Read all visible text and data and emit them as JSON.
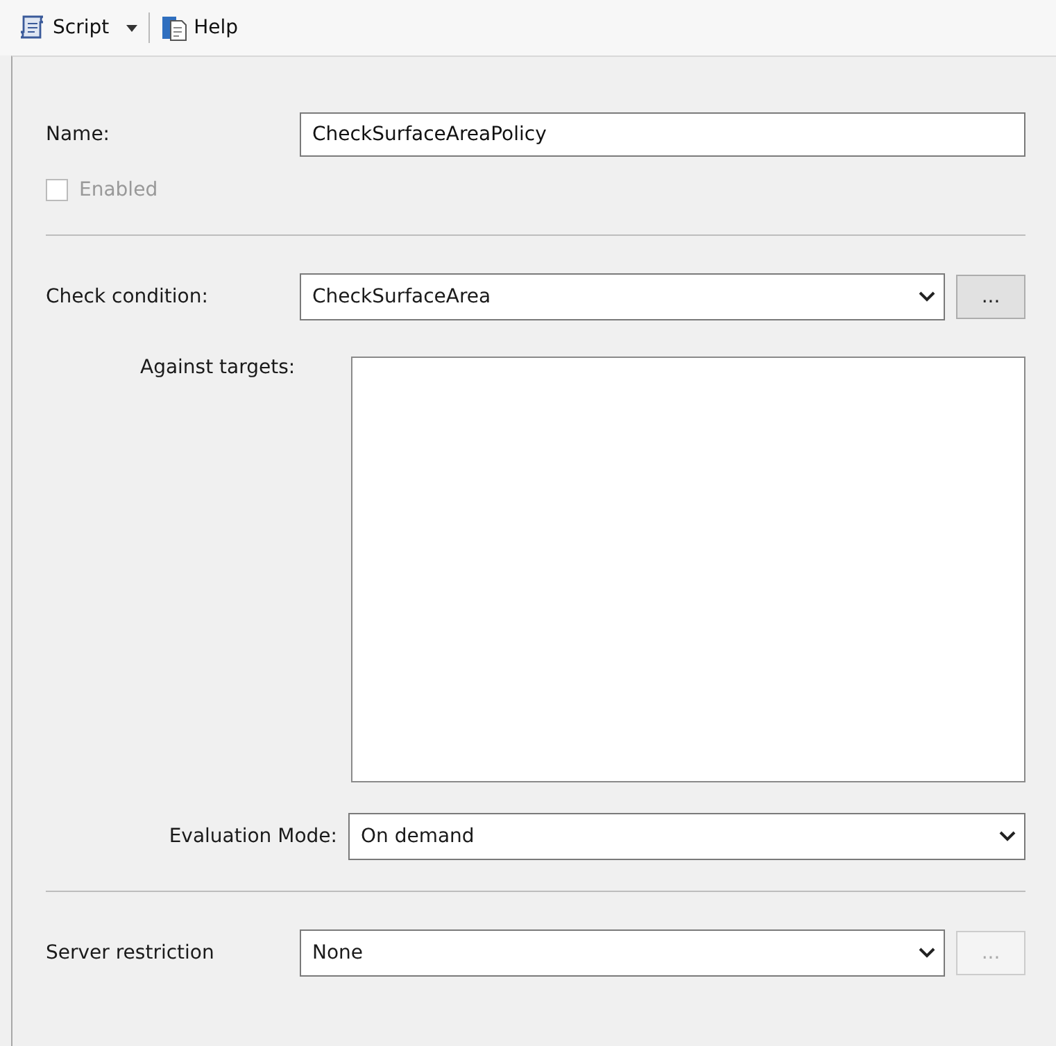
{
  "toolbar": {
    "items": [
      {
        "kind": "dropdown",
        "label": "Script"
      },
      {
        "kind": "button",
        "label": "Help"
      }
    ]
  },
  "name": {
    "label": "Name:",
    "value": "CheckSurfaceAreaPolicy"
  },
  "enabled": {
    "label": "Enabled",
    "checked": false,
    "disabled": true
  },
  "check_condition": {
    "label": "Check condition:",
    "value": "CheckSurfaceArea",
    "browse": {
      "label": "...",
      "disabled": false
    }
  },
  "against_targets": {
    "label": "Against targets:"
  },
  "evaluation_mode": {
    "label": "Evaluation Mode:",
    "value": "On demand"
  },
  "server_restriction": {
    "label": "Server restriction",
    "value": "None",
    "browse": {
      "label": "...",
      "disabled": true
    }
  }
}
